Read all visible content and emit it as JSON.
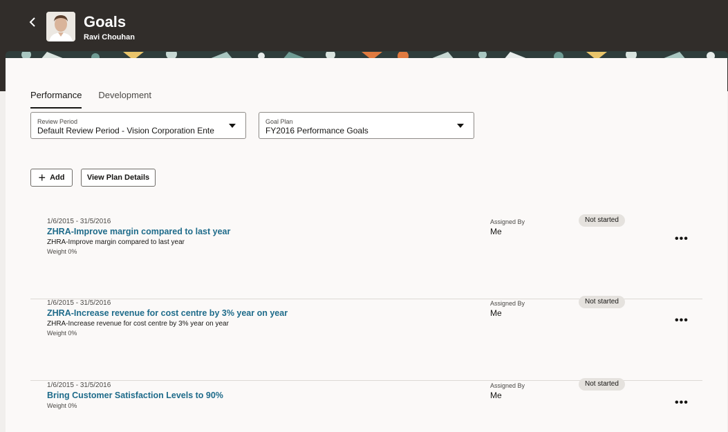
{
  "header": {
    "title": "Goals",
    "subtitle": "Ravi Chouhan"
  },
  "tabs": [
    {
      "label": "Performance",
      "active": true
    },
    {
      "label": "Development",
      "active": false
    }
  ],
  "filters": {
    "review_period": {
      "label": "Review Period",
      "value": "Default Review Period - Vision Corporation Ente"
    },
    "goal_plan": {
      "label": "Goal Plan",
      "value": "FY2016 Performance Goals"
    }
  },
  "actions": {
    "add_label": "Add",
    "view_plan_label": "View Plan Details"
  },
  "goals": [
    {
      "date": "1/6/2015 - 31/5/2016",
      "title": "ZHRA-Improve margin compared to last year",
      "description": "ZHRA-Improve margin compared to last year",
      "weight": "Weight 0%",
      "assigned_by_label": "Assigned By",
      "assigned_by": "Me",
      "status": "Not started",
      "more": "•••"
    },
    {
      "date": "1/6/2015 - 31/5/2016",
      "title": "ZHRA-Increase revenue for cost centre by 3% year on year",
      "description": "ZHRA-Increase revenue for cost centre by 3% year on year",
      "weight": "Weight 0%",
      "assigned_by_label": "Assigned By",
      "assigned_by": "Me",
      "status": "Not started",
      "more": "•••"
    },
    {
      "date": "1/6/2015 - 31/5/2016",
      "title": "Bring Customer Satisfaction Levels to 90%",
      "description": "",
      "weight": "Weight 0%",
      "assigned_by_label": "Assigned By",
      "assigned_by": "Me",
      "status": "Not started",
      "more": "•••"
    }
  ],
  "colors": {
    "header_bg": "#312d2a",
    "link": "#1e6b8a",
    "status_bg": "#e5e2de"
  }
}
